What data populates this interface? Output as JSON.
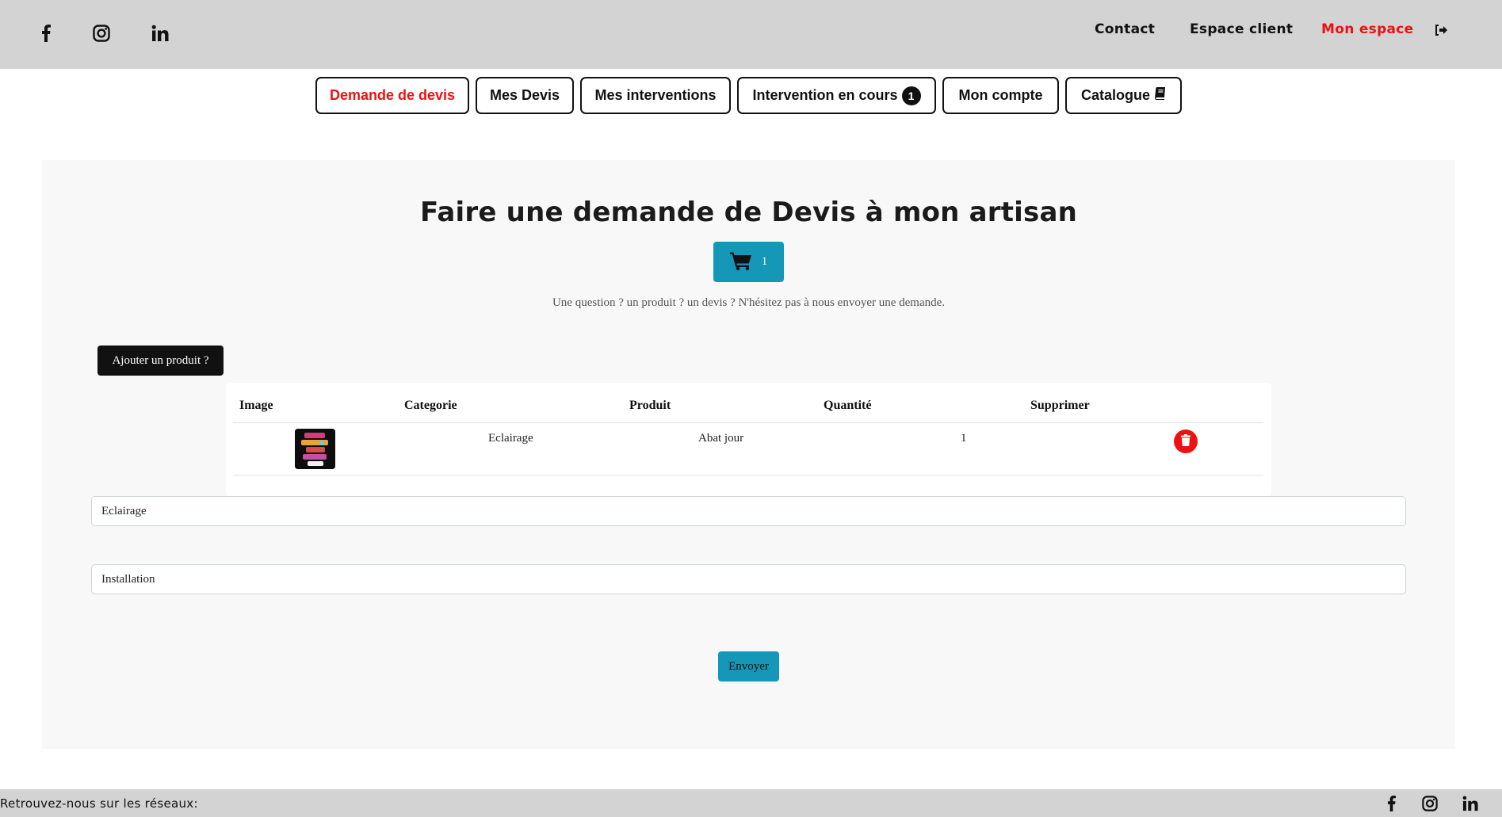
{
  "header": {
    "social": [
      {
        "name": "facebook-icon"
      },
      {
        "name": "instagram-icon"
      },
      {
        "name": "linkedin-icon"
      }
    ],
    "nav": [
      {
        "label": "Contact",
        "active": false
      },
      {
        "label": "Espace client",
        "active": false
      },
      {
        "label": "Mon espace",
        "active": true
      }
    ],
    "logout_icon": "sign-out-icon"
  },
  "tabs": [
    {
      "label": "Demande de devis",
      "active": true
    },
    {
      "label": "Mes Devis"
    },
    {
      "label": "Mes interventions"
    },
    {
      "label": "Intervention en cours",
      "badge": "1"
    },
    {
      "label": "Mon compte"
    },
    {
      "label": "Catalogue",
      "icon": "book-icon"
    }
  ],
  "main": {
    "title": "Faire une demande de Devis à mon artisan",
    "cart_count": "1",
    "subtitle": "Une question ? un produit ? un devis ? N'hésitez pas à nous envoyer une demande.",
    "add_product_label": "Ajouter un produit ?",
    "table": {
      "headers": [
        "Image",
        "Categorie",
        "Produit",
        "Quantité",
        "Supprimer"
      ],
      "rows": [
        {
          "categorie": "Eclairage",
          "produit": "Abat jour",
          "quantite": "1"
        }
      ]
    },
    "field_category": "Eclairage",
    "field_service": "Installation",
    "send_label": "Envoyer"
  },
  "footer": {
    "text": "Retrouvez-nous sur les réseaux:"
  },
  "colors": {
    "accent_red": "#ee1111",
    "teal": "#1597b7",
    "bar_gray": "#d3d3d3"
  }
}
